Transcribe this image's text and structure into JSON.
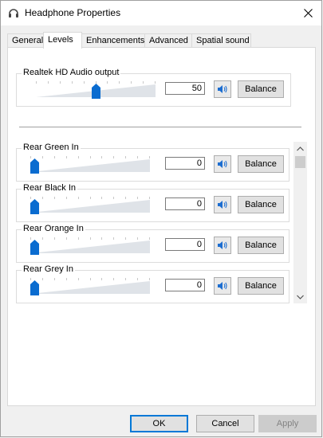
{
  "window": {
    "title": "Headphone Properties",
    "icon": "headphone-icon",
    "close_icon": "close-icon"
  },
  "tabs": [
    {
      "label": "General",
      "active": false
    },
    {
      "label": "Levels",
      "active": true
    },
    {
      "label": "Enhancements",
      "active": false
    },
    {
      "label": "Advanced",
      "active": false
    },
    {
      "label": "Spatial sound",
      "active": false
    }
  ],
  "main": {
    "label": "Realtek HD Audio output",
    "value": "50",
    "level": 0.5,
    "balance_label": "Balance",
    "mute_icon": "speaker-icon"
  },
  "inputs": [
    {
      "label": "Rear Green In",
      "value": "0",
      "level": 0,
      "balance_label": "Balance"
    },
    {
      "label": "Rear Black In",
      "value": "0",
      "level": 0,
      "balance_label": "Balance"
    },
    {
      "label": "Rear Orange In",
      "value": "0",
      "level": 0,
      "balance_label": "Balance"
    },
    {
      "label": "Rear Grey In",
      "value": "0",
      "level": 0,
      "balance_label": "Balance"
    }
  ],
  "footer": {
    "ok": "OK",
    "cancel": "Cancel",
    "apply": "Apply"
  },
  "colors": {
    "accent": "#0078d7",
    "speaker_icon": "#1c6dd0",
    "slider_thumb": "#0a6cd0"
  }
}
